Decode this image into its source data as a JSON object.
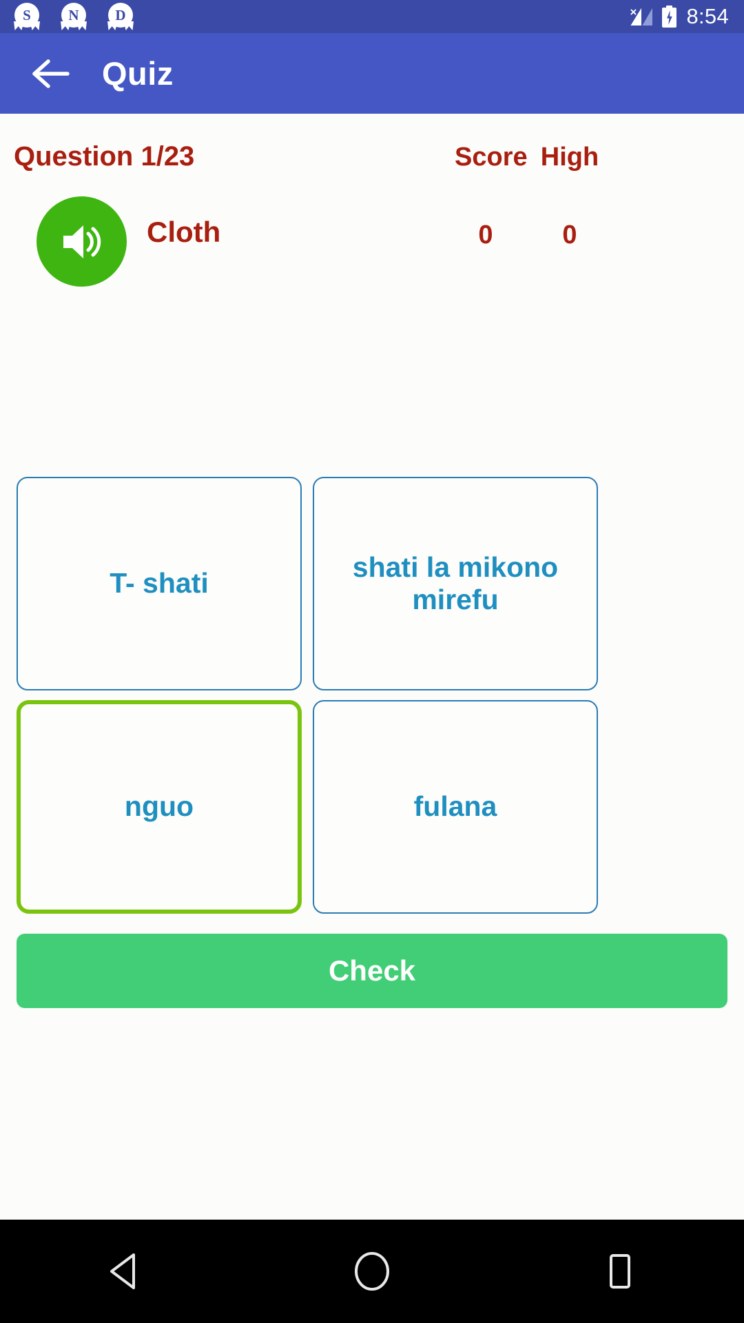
{
  "status_bar": {
    "notifications": [
      {
        "icon": "badge-s-icon",
        "letter": "S"
      },
      {
        "icon": "badge-n-icon",
        "letter": "N"
      },
      {
        "icon": "badge-d-icon",
        "letter": "D"
      }
    ],
    "signal_icon": "no-sim-signal-icon",
    "signal_x": "×",
    "battery_icon": "battery-charging-icon",
    "time": "8:54",
    "background_color": "#3a4aa6"
  },
  "app_bar": {
    "back_icon": "back-arrow-icon",
    "title": "Quiz",
    "background_color": "#4457c4",
    "text_color": "#ffffff"
  },
  "quiz": {
    "question_counter": "Question 1/23",
    "score_label": "Score",
    "score_value": "0",
    "high_label": "High",
    "high_value": "0",
    "speaker_icon": "speaker-volume-icon",
    "prompt_word": "Cloth",
    "accent_red": "#a81f10",
    "speaker_green": "#3fb512",
    "option_text_color": "#1f8fc0",
    "option_border_color": "#2a7bb3",
    "selected_border_color": "#7ac40f",
    "options": [
      {
        "label": "T- shati",
        "selected": false
      },
      {
        "label": "shati la mikono mirefu",
        "selected": false
      },
      {
        "label": "nguo",
        "selected": true
      },
      {
        "label": "fulana",
        "selected": false
      }
    ],
    "check_label": "Check",
    "check_color": "#41ce76"
  },
  "nav_bar": {
    "back_icon": "nav-back-triangle-icon",
    "home_icon": "nav-home-circle-icon",
    "recents_icon": "nav-recents-square-icon",
    "background_color": "#000000"
  }
}
